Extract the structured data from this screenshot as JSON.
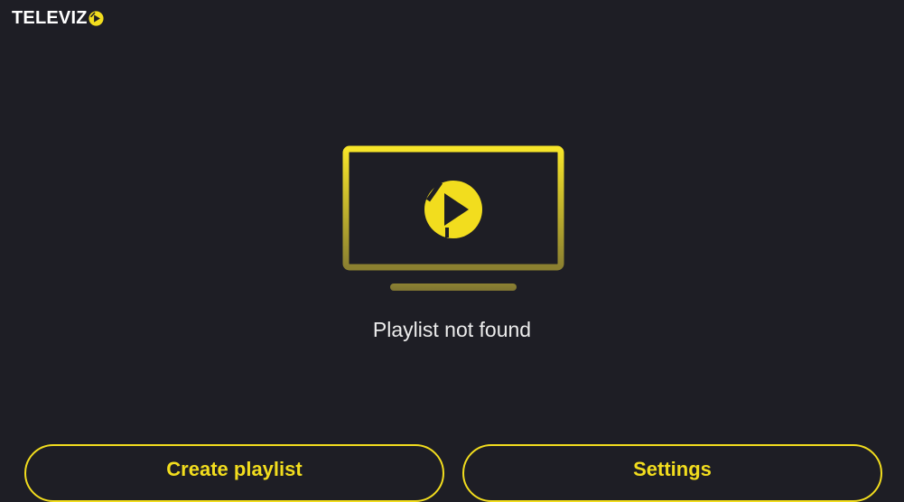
{
  "header": {
    "logo_text": "TELEVIZ",
    "logo_icon": "play-circle-logo-icon"
  },
  "empty_state": {
    "illustration": "tv-play-icon",
    "message": "Playlist not found"
  },
  "actions": {
    "create_playlist_label": "Create playlist",
    "settings_label": "Settings"
  },
  "colors": {
    "background": "#1e1e25",
    "accent": "#f2dd1e",
    "text": "#ececec"
  }
}
